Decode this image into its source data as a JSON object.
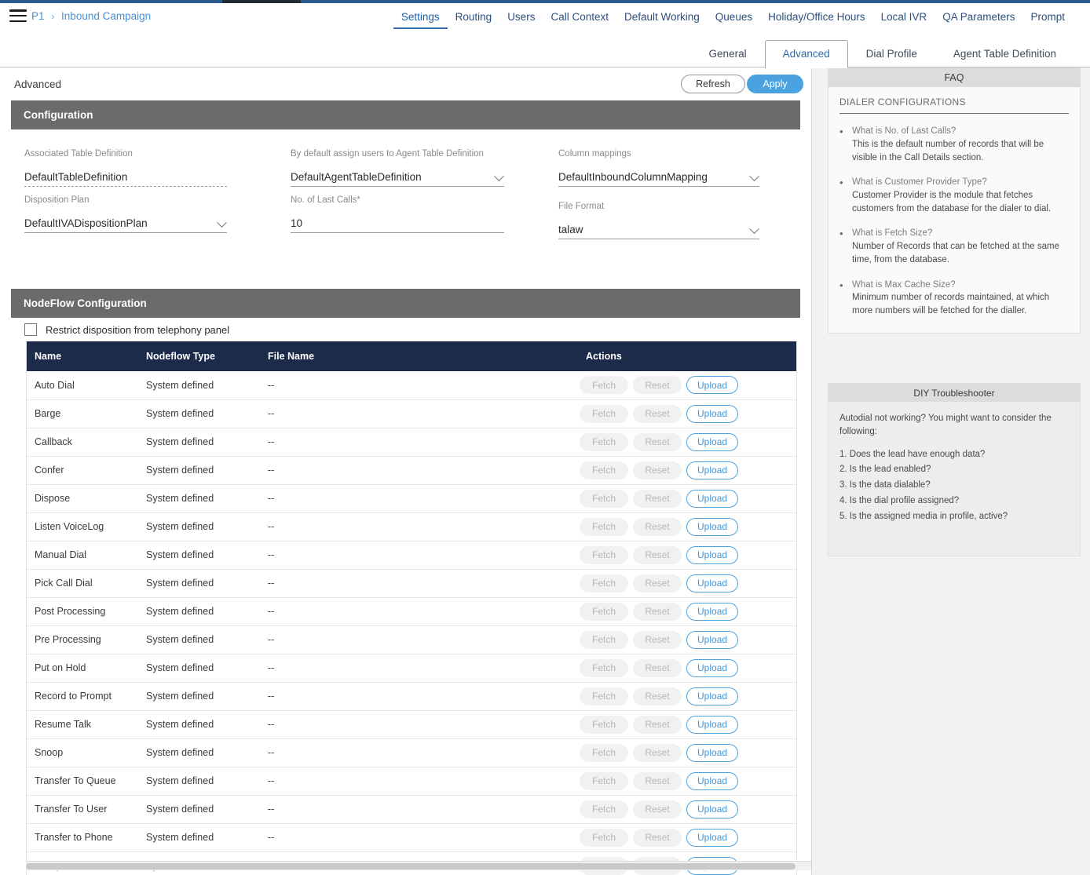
{
  "header": {
    "menu_icon": "hamburger-icon",
    "breadcrumb": {
      "root": "P1",
      "separator": "›",
      "current": "Inbound Campaign"
    },
    "nav": [
      {
        "label": "Settings",
        "active": true
      },
      {
        "label": "Routing",
        "active": false
      },
      {
        "label": "Users",
        "active": false
      },
      {
        "label": "Call Context",
        "active": false
      },
      {
        "label": "Default Working",
        "active": false
      },
      {
        "label": "Queues",
        "active": false
      },
      {
        "label": "Holiday/Office Hours",
        "active": false
      },
      {
        "label": "Local IVR",
        "active": false
      },
      {
        "label": "QA Parameters",
        "active": false
      },
      {
        "label": "Prompt",
        "active": false
      }
    ]
  },
  "subtabs": [
    {
      "label": "General",
      "active": false
    },
    {
      "label": "Advanced",
      "active": true
    },
    {
      "label": "Dial Profile",
      "active": false
    },
    {
      "label": "Agent Table Definition",
      "active": false
    }
  ],
  "page": {
    "title": "Advanced",
    "refresh_label": "Refresh",
    "apply_label": "Apply"
  },
  "configuration": {
    "section_title": "Configuration",
    "fields": [
      {
        "label": "Associated Table Definition",
        "value": "DefaultTableDefinition",
        "control": "text-readonly",
        "has_chevron": false
      },
      {
        "label": "By default assign users to Agent Table Definition",
        "value": "DefaultAgentTableDefinition",
        "control": "select",
        "has_chevron": true
      },
      {
        "label": "Column mappings",
        "value": "DefaultInboundColumnMapping",
        "control": "select",
        "has_chevron": true
      },
      {
        "label": "Disposition Plan",
        "value": "DefaultIVADispositionPlan",
        "control": "select",
        "has_chevron": true
      },
      {
        "label": "No. of Last Calls*",
        "value": "10",
        "control": "text",
        "has_chevron": false
      },
      {
        "label": "File Format",
        "value": "talaw",
        "control": "select",
        "has_chevron": true
      }
    ],
    "checkbox": {
      "label": "Restrict disposition from telephony panel",
      "checked": false
    }
  },
  "nodeflow": {
    "section_title": "NodeFlow Configuration",
    "columns": [
      "Name",
      "Nodeflow Type",
      "File Name",
      "Actions"
    ],
    "actions": {
      "fetch": "Fetch",
      "reset": "Reset",
      "upload": "Upload"
    },
    "rows": [
      {
        "name": "Auto Dial",
        "type": "System defined",
        "file": "--"
      },
      {
        "name": "Barge",
        "type": "System defined",
        "file": "--"
      },
      {
        "name": "Callback",
        "type": "System defined",
        "file": "--"
      },
      {
        "name": "Confer",
        "type": "System defined",
        "file": "--"
      },
      {
        "name": "Dispose",
        "type": "System defined",
        "file": "--"
      },
      {
        "name": "Listen VoiceLog",
        "type": "System defined",
        "file": "--"
      },
      {
        "name": "Manual Dial",
        "type": "System defined",
        "file": "--"
      },
      {
        "name": "Pick Call Dial",
        "type": "System defined",
        "file": "--"
      },
      {
        "name": "Post Processing",
        "type": "System defined",
        "file": "--"
      },
      {
        "name": "Pre Processing",
        "type": "System defined",
        "file": "--"
      },
      {
        "name": "Put on Hold",
        "type": "System defined",
        "file": "--"
      },
      {
        "name": "Record to Prompt",
        "type": "System defined",
        "file": "--"
      },
      {
        "name": "Resume Talk",
        "type": "System defined",
        "file": "--"
      },
      {
        "name": "Snoop",
        "type": "System defined",
        "file": "--"
      },
      {
        "name": "Transfer To Queue",
        "type": "System defined",
        "file": "--"
      },
      {
        "name": "Transfer To User",
        "type": "System defined",
        "file": "--"
      },
      {
        "name": "Transfer to Phone",
        "type": "System defined",
        "file": "--"
      },
      {
        "name": "Whisper",
        "type": "System defined",
        "file": "--"
      }
    ]
  },
  "faq": {
    "title": "FAQ",
    "section_title": "DIALER CONFIGURATIONS",
    "items": [
      {
        "question": "What is No. of Last Calls?",
        "answer": "This is the default number of records that will be visible in the Call Details section."
      },
      {
        "question": "What is Customer Provider Type?",
        "answer": "Customer Provider is the module that fetches customers from the database for the dialer to dial."
      },
      {
        "question": "What is Fetch Size?",
        "answer": "Number of Records that can be fetched at the same time, from the database."
      },
      {
        "question": "What is Max Cache Size?",
        "answer": "Minimum number of records maintained, at which more numbers will be fetched for the dialler."
      }
    ]
  },
  "troubleshooter": {
    "title": "DIY Troubleshooter",
    "intro": "Autodial not working? You might want to consider the following:",
    "steps": [
      "1. Does the lead have enough data?",
      "2. Is the lead enabled?",
      "3. Is the data dialable?",
      "4. Is the dial profile assigned?",
      "5. Is the assigned media in profile, active?"
    ]
  },
  "colors": {
    "accent_blue": "#4aa3e0",
    "nav_blue": "#2c6bb0",
    "table_header": "#1c2b4a",
    "section_bar": "#6b6b6b",
    "breadcrumb_link": "#5b9bd5"
  }
}
